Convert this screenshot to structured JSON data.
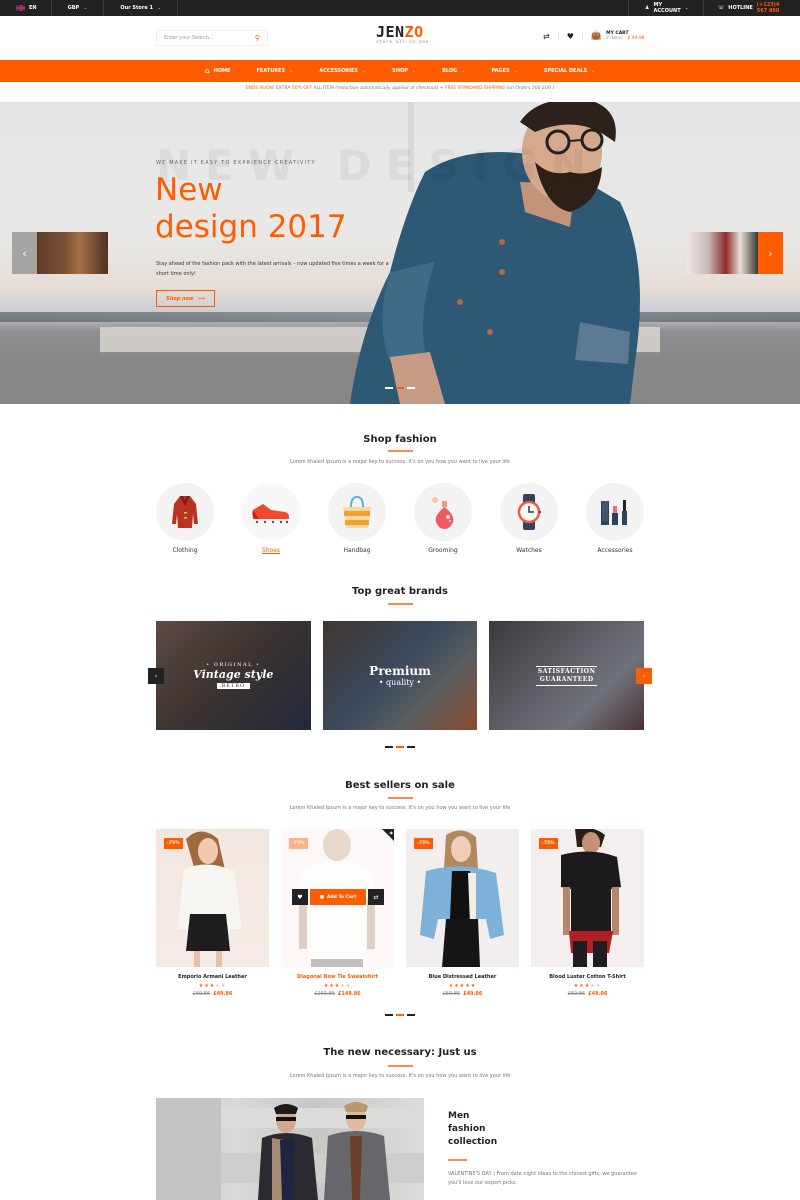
{
  "topbar": {
    "language": "EN",
    "currency": "GBP",
    "store": "Our Store 1",
    "account": "MY ACCOUNT",
    "hotline_label": "HOTLINE",
    "hotline_number": "(+123)4 567 890"
  },
  "header": {
    "search_placeholder": "Enter your Search...",
    "logo_prefix": "JEN",
    "logo_suffix": "ZO",
    "logo_tagline": "store all in one",
    "cart_title": "MY CART",
    "cart_items": "2 items -",
    "cart_total": "$ 49.98"
  },
  "nav": {
    "items": [
      {
        "label": "HOME",
        "dropdown": false
      },
      {
        "label": "FEATURES",
        "dropdown": true
      },
      {
        "label": "ACCESSORIES",
        "dropdown": true
      },
      {
        "label": "SHOP",
        "dropdown": true
      },
      {
        "label": "BLOG",
        "dropdown": true
      },
      {
        "label": "PAGES",
        "dropdown": true
      },
      {
        "label": "SPECIAL DEALS",
        "dropdown": true
      }
    ]
  },
  "promo": {
    "part1": "ENDS SOON:",
    "part2": " EXTRA ",
    "part3": "50% OFF",
    "part4": " ALL ITEM ",
    "part5": "(reduction automatically applied at checkout)",
    "part6": " + ",
    "part7": "FREE STANDARD SHIPPING",
    "part8": " (on Orders 300 EUR )"
  },
  "hero": {
    "watermark": "NEW DESIGN",
    "eyebrow": "WE MAKE IT EASY TO EXPRIENCE CREATIVITY",
    "title_line1": "New",
    "title_line2": "design 2017",
    "description": "Stay ahead of the fashion pack with the latest arrivals – now updated five times a week for a short time only!",
    "button": "Shop now",
    "active_slide": 2,
    "slide_count": 3
  },
  "shop_fashion": {
    "title": "Shop fashion",
    "subtitle": "Lorem khaled ipsum is a major key to success. It's on you how you want to live your life",
    "categories": [
      {
        "label": "Clothing",
        "icon": "coat-icon"
      },
      {
        "label": "Shoes",
        "icon": "sneaker-icon",
        "active": true
      },
      {
        "label": "Handbag",
        "icon": "handbag-icon"
      },
      {
        "label": "Grooming",
        "icon": "perfume-icon"
      },
      {
        "label": "Watches",
        "icon": "watch-icon"
      },
      {
        "label": "Accessories",
        "icon": "cosmetics-icon"
      }
    ]
  },
  "brands": {
    "title": "Top great brands",
    "items": [
      {
        "line1": "• ORIGINAL •",
        "line2": "Vintage style",
        "line3": "RETRO"
      },
      {
        "line1": "Premium",
        "line2": "• quality •"
      },
      {
        "line1": "SATISFACTION",
        "line2": "GUARANTEED"
      }
    ],
    "active_page": 2,
    "page_count": 3
  },
  "best_sellers": {
    "title": "Best sellers on sale",
    "subtitle": "Lorem Khaled Ipsum is a major key to success. It's on you how you want to live your life",
    "add_to_cart": "Add To Cart",
    "products": [
      {
        "name": "Emporio Armani Leather",
        "badge": "-75%",
        "rating": 3,
        "old_price": "£69.86",
        "new_price": "£49.86"
      },
      {
        "name": "Diagonal Bow Tie Sweatshirt",
        "badge": "-75%",
        "rating": 3,
        "old_price": "£269.86",
        "new_price": "£149.86",
        "hovered": true
      },
      {
        "name": "Blue Distressed Leather",
        "badge": "-75%",
        "rating": 5,
        "old_price": "£69.86",
        "new_price": "£49.86"
      },
      {
        "name": "Blood Luster Cotton T-Shirt",
        "badge": "-75%",
        "rating": 3,
        "old_price": "£69.86",
        "new_price": "£49.86"
      }
    ],
    "active_page": 2,
    "page_count": 3
  },
  "necessary": {
    "title": "The new necessary: Just us",
    "subtitle": "Lorem Khaled Ipsum is a major key to success. It's on you how you want to live your life",
    "collection_title_1": "Men",
    "collection_title_2": "fashion",
    "collection_title_3": "collection",
    "collection_desc": "VALENTINE'S DAY | From date night ideas to the chicest gifts, we guarantee you'll love our expert picks."
  },
  "colors": {
    "accent": "#ff5c00",
    "topbar": "#222222"
  }
}
